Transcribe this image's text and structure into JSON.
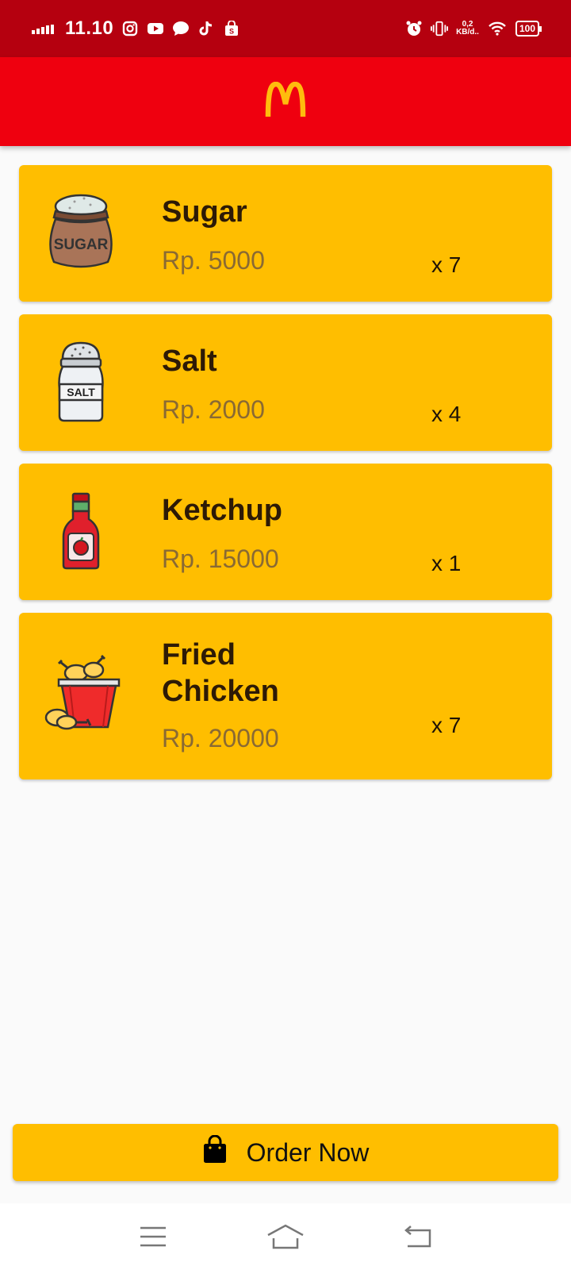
{
  "status_bar": {
    "time": "11.10",
    "net_speed_value": "0,2",
    "net_speed_unit": "KB/d..",
    "battery": "100",
    "left_icons": [
      "instagram-icon",
      "youtube-icon",
      "chat-icon",
      "tiktok-icon",
      "shopee-icon"
    ],
    "right_icons": [
      "alarm-icon",
      "vibrate-icon",
      "wifi-icon"
    ]
  },
  "app_bar": {
    "logo": "mcdonalds-logo",
    "colors": {
      "background": "#ef000f",
      "logo": "#ffbc0d"
    }
  },
  "items": [
    {
      "name": "Sugar",
      "price": "Rp. 5000",
      "qty": "x 7",
      "icon": "sugar-sack-icon",
      "icon_text": "SUGAR"
    },
    {
      "name": "Salt",
      "price": "Rp. 2000",
      "qty": "x 4",
      "icon": "salt-shaker-icon",
      "icon_text": "SALT"
    },
    {
      "name": "Ketchup",
      "price": "Rp. 15000",
      "qty": "x 1",
      "icon": "ketchup-bottle-icon"
    },
    {
      "name": "Fried Chicken",
      "price": "Rp. 20000",
      "qty": "x 7",
      "icon": "fried-chicken-bucket-icon"
    }
  ],
  "order_button": {
    "label": "Order Now",
    "icon": "shopping-bag-icon"
  },
  "colors": {
    "status_bar": "#b5000f",
    "card": "#ffbe00",
    "title_text": "#2d1a06",
    "price_text": "#8a6a33"
  },
  "nav_bar": {
    "icons": [
      "menu-icon",
      "home-icon",
      "back-icon"
    ]
  }
}
